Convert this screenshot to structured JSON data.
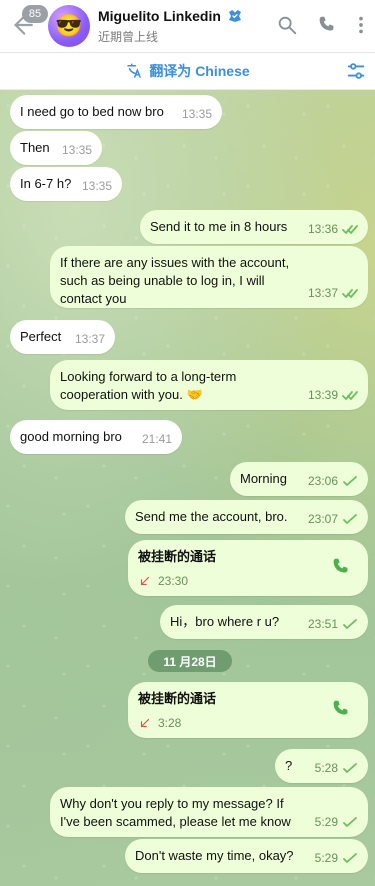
{
  "header": {
    "badge_count": "85",
    "name": "Miguelito Linkedin",
    "status": "近期曾上线",
    "avatar_emoji": "😎"
  },
  "translate_bar": {
    "label": "翻译为 Chinese"
  },
  "date_pill": "11 月28日",
  "messages": [
    {
      "text": "I need go to bed now bro",
      "time": "13:35"
    },
    {
      "text": "Then",
      "time": "13:35"
    },
    {
      "text": "In 6-7 h?",
      "time": "13:35"
    },
    {
      "text": "Send it to me in 8 hours",
      "time": "13:36"
    },
    {
      "text": "If there are any issues with the account, such as being unable to log in, I will contact you",
      "time": "13:37"
    },
    {
      "text": "Perfect",
      "time": "13:37"
    },
    {
      "text": "Looking forward to a long-term cooperation with you. 🤝",
      "time": "13:39"
    },
    {
      "text": "good morning bro",
      "time": "21:41"
    },
    {
      "text": "Morning",
      "time": "23:06"
    },
    {
      "text": "Send me the account, bro.",
      "time": "23:07"
    },
    {
      "call_title": "被挂断的通话",
      "time": "23:30"
    },
    {
      "text": "Hi，bro  where r u?",
      "time": "23:51"
    },
    {
      "call_title": "被挂断的通话",
      "time": "3:28"
    },
    {
      "text": "?",
      "time": "5:28"
    },
    {
      "text": "Why don't you reply to my message? If I've been scammed, please let me know",
      "time": "5:29"
    },
    {
      "text": "Don't waste my time, okay?",
      "time": "5:29"
    }
  ],
  "colors": {
    "accent": "#3f8ed8",
    "outgoing_bubble": "#eefed8",
    "incoming_bubble": "#ffffff",
    "date_pill": "#6f9d70",
    "missed_call_red": "#d9534f",
    "call_icon_green": "#4caf50"
  },
  "icons": [
    "back-arrow-icon",
    "search-icon",
    "phone-icon",
    "more-vert-icon",
    "translate-icon",
    "translate-settings-icon",
    "double-check-icon",
    "check-icon",
    "missed-call-arrow-icon"
  ]
}
